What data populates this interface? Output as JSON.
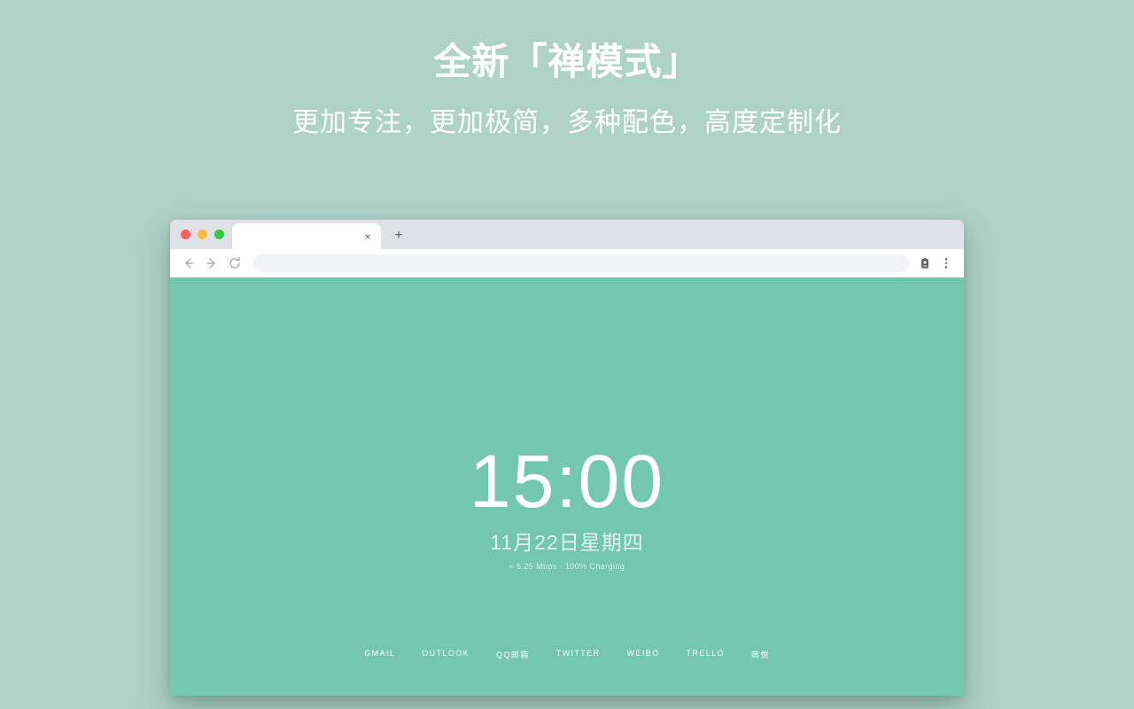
{
  "promo": {
    "title": "全新「禅模式」",
    "subtitle": "更加专注，更加极简，多种配色，高度定制化"
  },
  "browser": {
    "window_controls": {
      "close": "close",
      "minimize": "minimize",
      "maximize": "maximize"
    },
    "tab": {
      "title": "",
      "close_label": "×"
    },
    "new_tab_label": "+",
    "toolbar": {
      "back": "back",
      "forward": "forward",
      "reload": "reload",
      "address_value": "",
      "address_placeholder": "",
      "profile": "profile",
      "menu": "menu"
    }
  },
  "zen": {
    "time": "15:00",
    "date": "11月22日星期四",
    "status": "≈ 5.25 Mbps · 100% Charging",
    "links": [
      {
        "label": "GMAIL"
      },
      {
        "label": "OUTLOOK"
      },
      {
        "label": "QQ邮箱"
      },
      {
        "label": "TWITTER"
      },
      {
        "label": "WEIBO"
      },
      {
        "label": "TRELLO"
      },
      {
        "label": "简悦"
      }
    ]
  },
  "colors": {
    "page_background": "#aed3c6",
    "zen_background": "#72c7ac",
    "chrome_tabstrip": "#dee1e6",
    "chrome_toolbar": "#ffffff",
    "omnibox": "#f1f3f4",
    "traffic_close": "#fc6058",
    "traffic_min": "#fdbc40",
    "traffic_max": "#34c849"
  }
}
